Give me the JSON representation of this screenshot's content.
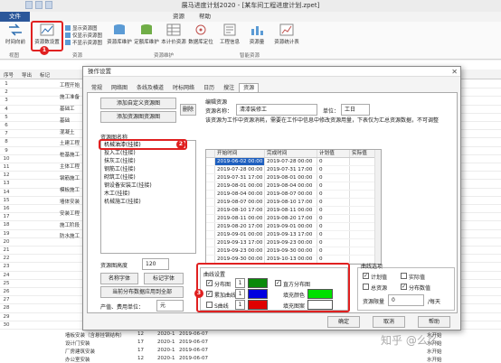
{
  "window": {
    "title": "展马进度计划2020 - [某车间工程进度计划.zpet]"
  },
  "menu": {
    "file": "文件",
    "tabs": [
      "资源",
      "帮助"
    ]
  },
  "ribbon": {
    "time_forward": "时间向前",
    "resource_settings": "资源数设置",
    "show_resource_chart": "显示资源图",
    "show_only_resource": "仅显示资源图",
    "hide_resource_chart": "不显示资源图",
    "resource_maintenance": "资源库维护",
    "quota_maintenance": "定额库维护",
    "local_quota": "本计价资源",
    "data_settings": "数据库定位",
    "engineering_settings": "工程信息",
    "resource_collect": "资源量",
    "resource_statistics": "资源统计表",
    "groups": [
      "视图",
      "资源",
      "资源维护",
      "智能资源"
    ]
  },
  "grid": {
    "headers": [
      "序号",
      "导出",
      "标记"
    ],
    "rownums": [
      "1",
      "2",
      "3",
      "4",
      "5",
      "6",
      "7",
      "8",
      "9",
      "10",
      "11",
      "12",
      "13",
      "14",
      "15",
      "16",
      "17",
      "18",
      "19",
      "20",
      "21",
      "22",
      "23",
      "24",
      "25",
      "26",
      "27",
      "28",
      "29",
      "30"
    ],
    "snippets": [
      "工程开始",
      "施工准备",
      "基础工",
      "基础",
      "混凝土",
      "土建工程",
      "桩基施工",
      "主体工程",
      "钢筋施工",
      "模板施工",
      "墙体安装",
      "安装工程",
      "施工阶段",
      "防水施工"
    ],
    "bottom_rows": [
      {
        "name": "墙板安装（含悬挂钢结构）",
        "d": "12",
        "s": "2020-1",
        "e": "2019-06-07",
        "r": "水开始"
      },
      {
        "name": "设计门安装",
        "d": "17",
        "s": "2020-1",
        "e": "2019-06-07",
        "r": "水开始"
      },
      {
        "name": "厂房建筑安装",
        "d": "17",
        "s": "2020-1",
        "e": "2019-06-07",
        "r": "水开始"
      },
      {
        "name": "办公室安装",
        "d": "12",
        "s": "2020-1",
        "e": "2019-06-07",
        "r": "水开始"
      }
    ]
  },
  "dialog": {
    "title": "操作设置",
    "close": "✕",
    "tabs": [
      "常规",
      "网络图",
      "条线及横道",
      "时标网络",
      "日历",
      "搜注",
      "资源"
    ],
    "add_custom_resource": "添加自定义资源图",
    "add_resource_chart": "添加资源图资源图",
    "delete": "删除",
    "resource_name_label": "资源图名称",
    "resource_list": [
      "机械油漆(挂接)",
      "投入工(挂接)",
      "抹灰工(挂接)",
      "钢筋工(挂接)",
      "砌筑工(挂接)",
      "钢设备安装工(挂接)",
      "木工(挂接)",
      "机械施工(挂接)"
    ],
    "chart_height_label": "资源图高度",
    "chart_height_value": "120",
    "font_label": "名称字体",
    "tick_font_label": "标记字体",
    "apply_all": "当前分布数据应用到全部",
    "unit_label": "产值、费用单位：",
    "unit_value": "元",
    "edit_resource_label": "编辑资源",
    "resource_name": "资源名称：",
    "resource_name_value": "清漆装修工",
    "unit": "单位：",
    "unit_field": "工日",
    "desc": "该资源为工作中资源消耗，需要在工作中信息中修改资源用量，下表仅为汇总资源数据，不可调整",
    "table_headers": [
      "开始时间",
      "完成时间",
      "计划值",
      "实际值"
    ],
    "table_rows": [
      {
        "s": "2019-06-02 00:00",
        "e": "2019-07-28 00:00",
        "p": "0",
        "a": ""
      },
      {
        "s": "2019-07-28 00:00",
        "e": "2019-07-31 17:00",
        "p": "0",
        "a": ""
      },
      {
        "s": "2019-07-31 17:00",
        "e": "2019-08-01 00:00",
        "p": "0",
        "a": ""
      },
      {
        "s": "2019-08-01 00:00",
        "e": "2019-08-04 00:00",
        "p": "0",
        "a": ""
      },
      {
        "s": "2019-08-04 00:00",
        "e": "2019-08-07 00:00",
        "p": "0",
        "a": ""
      },
      {
        "s": "2019-08-07 00:00",
        "e": "2019-08-10 17:00",
        "p": "0",
        "a": ""
      },
      {
        "s": "2019-08-10 17:00",
        "e": "2019-08-11 00:00",
        "p": "0",
        "a": ""
      },
      {
        "s": "2019-08-11 00:00",
        "e": "2019-08-20 17:00",
        "p": "0",
        "a": ""
      },
      {
        "s": "2019-08-20 17:00",
        "e": "2019-09-01 00:00",
        "p": "0",
        "a": ""
      },
      {
        "s": "2019-09-01 00:00",
        "e": "2019-09-13 17:00",
        "p": "0",
        "a": ""
      },
      {
        "s": "2019-09-13 17:00",
        "e": "2019-09-23 00:00",
        "p": "0",
        "a": ""
      },
      {
        "s": "2019-09-23 00:00",
        "e": "2019-09-30 00:00",
        "p": "0",
        "a": ""
      },
      {
        "s": "2019-09-30 00:00",
        "e": "2019-10-13 00:00",
        "p": "0",
        "a": ""
      }
    ],
    "curve_settings_label": "曲线设置",
    "distribution_chart": "分布图",
    "cumulative_chart": "累加曲线",
    "s_chart": "S曲线",
    "distribution_chart_2": "直方分布图",
    "fill_color": "填充颜色",
    "fill_pattern": "填充图案",
    "spin_values": [
      "1",
      "1",
      "1"
    ],
    "curve_options_label": "曲线选项",
    "plan_amount": "计划值",
    "actual_amount": "实际值",
    "total_amount": "总资源",
    "distribution_amount": "分布数值",
    "resource_limit": "资源限量",
    "resource_limit_value": "0",
    "per_day": "/每天",
    "ok": "确定",
    "cancel": "取消",
    "help": "帮助"
  },
  "badges": [
    "1",
    "2",
    "3"
  ],
  "watermark": "知乎 @么么",
  "colors": {
    "green": "#0a8a0a",
    "blue": "#0000e0",
    "red": "#e00000",
    "bright_green": "#00e000",
    "highlight": "#e02020"
  }
}
